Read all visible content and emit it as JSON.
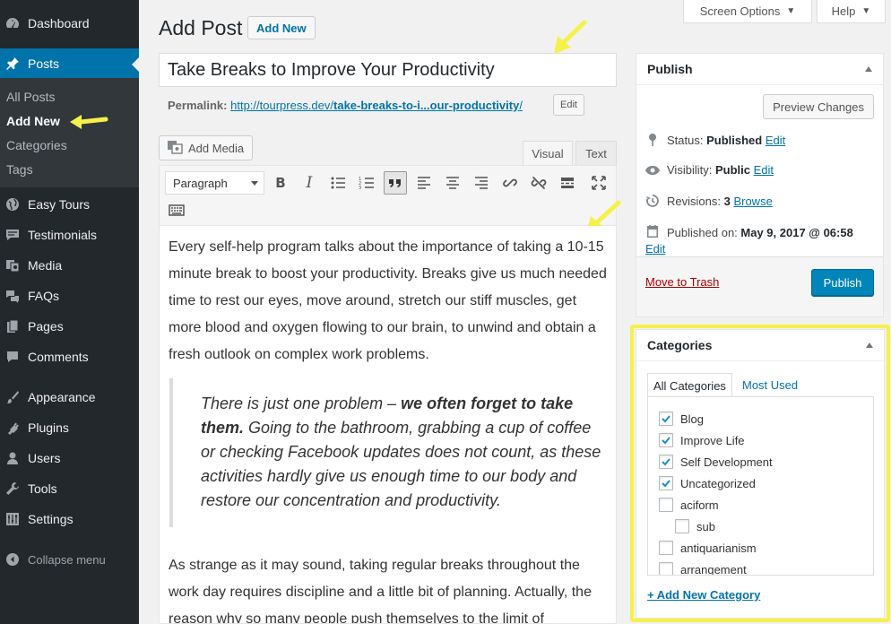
{
  "sidebar": {
    "items": [
      {
        "label": "Dashboard",
        "icon": "dashboard-icon"
      },
      {
        "label": "Posts",
        "icon": "pin-icon"
      },
      {
        "label": "Easy Tours",
        "icon": "globe-icon"
      },
      {
        "label": "Testimonials",
        "icon": "speech-bubble-icon"
      },
      {
        "label": "Media",
        "icon": "media-icon"
      },
      {
        "label": "FAQs",
        "icon": "chat-bubbles-icon"
      },
      {
        "label": "Pages",
        "icon": "pages-icon"
      },
      {
        "label": "Comments",
        "icon": "comment-icon"
      },
      {
        "label": "Appearance",
        "icon": "paintbrush-icon"
      },
      {
        "label": "Plugins",
        "icon": "plug-icon"
      },
      {
        "label": "Users",
        "icon": "user-icon"
      },
      {
        "label": "Tools",
        "icon": "wrench-icon"
      },
      {
        "label": "Settings",
        "icon": "settings-icon"
      }
    ],
    "submenu": [
      "All Posts",
      "Add New",
      "Categories",
      "Tags"
    ],
    "collapse_label": "Collapse menu"
  },
  "screen_options_label": "Screen Options",
  "help_label": "Help",
  "page_title": "Add Post",
  "add_new_label": "Add New",
  "post_title": "Take Breaks to Improve Your Productivity",
  "permalink": {
    "label": "Permalink:",
    "url_prefix": "http://tourpress.dev/",
    "url_slug": "take-breaks-to-i...our-productivity",
    "url_suffix": "/",
    "edit_label": "Edit"
  },
  "editor": {
    "add_media_label": "Add Media",
    "tab_visual": "Visual",
    "tab_text": "Text",
    "format_value": "Paragraph",
    "paragraph1": "Every self-help program talks about the importance of taking a 10-15 minute break to boost your productivity. Breaks give us much needed time to rest our eyes, move around, stretch our stiff muscles, get more blood and oxygen flowing to our brain, to unwind and obtain a fresh outlook on complex work problems.",
    "quote_part1": "There is just one problem – ",
    "quote_bold": "we often forget to take them.",
    "quote_part2": "  Going to the bathroom, grabbing a cup of coffee or checking Facebook updates does not count, as these activities hardly give us enough time to our body and restore our concentration and productivity.",
    "paragraph2": "As strange as it may sound, taking regular breaks throughout the work day requires discipline and a little bit of planning. Actually, the reason why so many people push themselves to the limit of"
  },
  "publish_box": {
    "title": "Publish",
    "preview_label": "Preview Changes",
    "status_label": "Status:",
    "status_value": "Published",
    "visibility_label": "Visibility:",
    "visibility_value": "Public",
    "revisions_label": "Revisions:",
    "revisions_value": "3",
    "browse_label": "Browse",
    "published_on_label": "Published on:",
    "published_on_value": "May 9, 2017 @ 06:58",
    "edit_label": "Edit",
    "trash_label": "Move to Trash",
    "publish_label": "Publish"
  },
  "categories_box": {
    "title": "Categories",
    "tab_all": "All Categories",
    "tab_used": "Most Used",
    "items": [
      {
        "label": "Blog",
        "checked": true
      },
      {
        "label": "Improve Life",
        "checked": true
      },
      {
        "label": "Self Development",
        "checked": true
      },
      {
        "label": "Uncategorized",
        "checked": true
      },
      {
        "label": "aciform",
        "checked": false
      },
      {
        "label": "sub",
        "checked": false
      },
      {
        "label": "antiquarianism",
        "checked": false
      },
      {
        "label": "arrangement",
        "checked": false
      }
    ],
    "add_new_label": "+ Add New Category"
  },
  "colors": {
    "sidebar_bg": "#23282d",
    "accent": "#0073aa",
    "publish_button": "#0085ba",
    "annotation": "#f6f14a"
  }
}
